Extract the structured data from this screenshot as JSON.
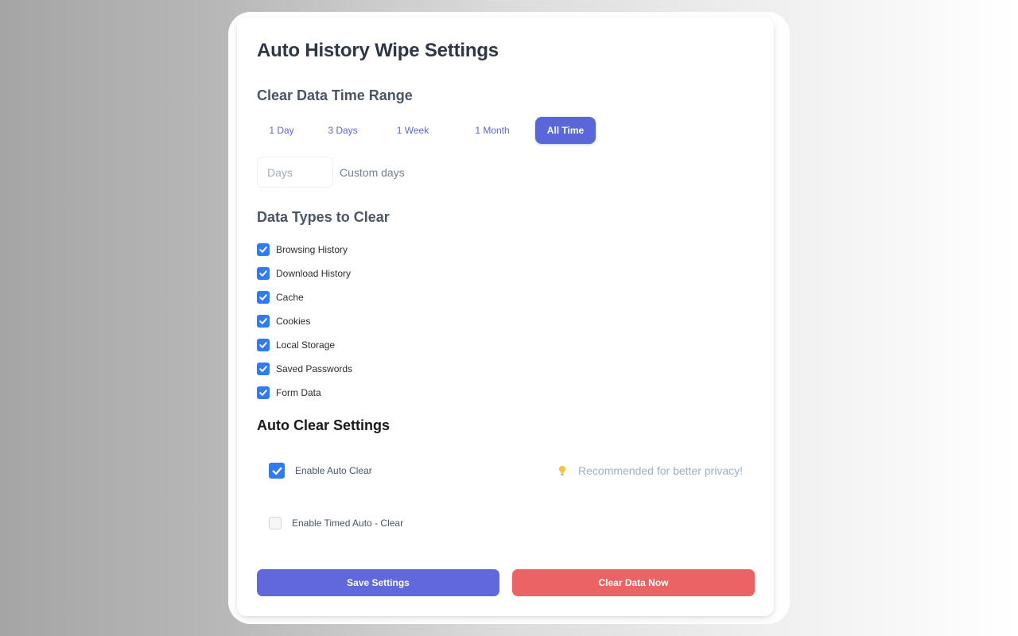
{
  "title": "Auto History Wipe Settings",
  "sections": {
    "time_range": {
      "heading": "Clear Data Time Range",
      "options": [
        {
          "label": "1 Day",
          "active": false
        },
        {
          "label": "3 Days",
          "active": false
        },
        {
          "label": "1 Week",
          "active": false
        },
        {
          "label": "1 Month",
          "active": false
        },
        {
          "label": "All Time",
          "active": true
        }
      ],
      "custom": {
        "placeholder": "Days",
        "value": "",
        "label": "Custom days"
      }
    },
    "data_types": {
      "heading": "Data Types to Clear",
      "items": [
        {
          "label": "Browsing History",
          "checked": true
        },
        {
          "label": "Download History",
          "checked": true
        },
        {
          "label": "Cache",
          "checked": true
        },
        {
          "label": "Cookies",
          "checked": true
        },
        {
          "label": "Local Storage",
          "checked": true
        },
        {
          "label": "Saved Passwords",
          "checked": true
        },
        {
          "label": "Form Data",
          "checked": true
        }
      ]
    },
    "auto_clear": {
      "heading": "Auto Clear Settings",
      "enable_auto_clear": {
        "label": "Enable Auto Clear",
        "checked": true
      },
      "tip": {
        "icon": "lightbulb-icon",
        "text": "Recommended for better privacy!"
      },
      "enable_timed": {
        "label": "Enable Timed Auto - Clear",
        "checked": false
      }
    }
  },
  "actions": {
    "save_label": "Save Settings",
    "clear_label": "Clear Data Now"
  },
  "colors": {
    "accent": "#5a67d8",
    "checkbox": "#2f7bf5",
    "danger": "#e96463",
    "tip_icon": "#f6c343"
  }
}
